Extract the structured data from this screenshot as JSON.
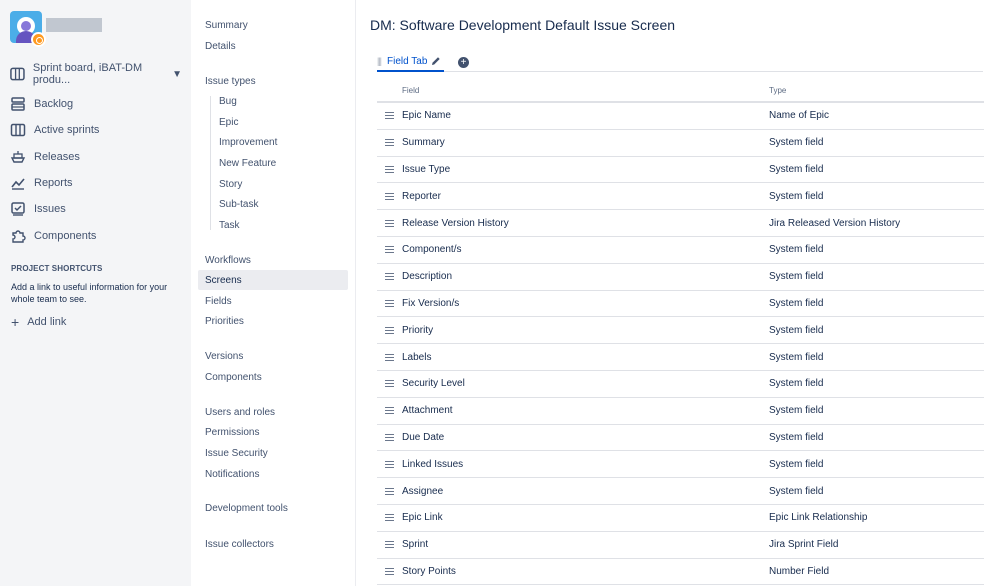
{
  "sidebar": {
    "board_label": "Sprint board, iBAT-DM produ...",
    "items": [
      {
        "label": "Backlog",
        "icon": "backlog-icon"
      },
      {
        "label": "Active sprints",
        "icon": "board-columns-icon"
      },
      {
        "label": "Releases",
        "icon": "ship-icon"
      },
      {
        "label": "Reports",
        "icon": "chart-icon"
      },
      {
        "label": "Issues",
        "icon": "issues-icon"
      },
      {
        "label": "Components",
        "icon": "puzzle-icon"
      }
    ],
    "shortcuts_title": "PROJECT SHORTCUTS",
    "shortcuts_desc": "Add a link to useful information for your whole team to see.",
    "add_link": "Add link"
  },
  "settings_nav": {
    "summary": "Summary",
    "details": "Details",
    "issue_types": "Issue types",
    "issue_type_items": [
      "Bug",
      "Epic",
      "Improvement",
      "New Feature",
      "Story",
      "Sub-task",
      "Task"
    ],
    "workflows": "Workflows",
    "screens": "Screens",
    "fields": "Fields",
    "priorities": "Priorities",
    "versions": "Versions",
    "components": "Components",
    "users_roles": "Users and roles",
    "permissions": "Permissions",
    "issue_security": "Issue Security",
    "notifications": "Notifications",
    "dev_tools": "Development tools",
    "issue_collectors": "Issue collectors"
  },
  "main": {
    "title": "DM: Software Development Default Issue Screen",
    "tab_label": "Field Tab",
    "columns": {
      "field": "Field",
      "type": "Type"
    },
    "rows": [
      {
        "field": "Epic Name",
        "type": "Name of Epic"
      },
      {
        "field": "Summary",
        "type": "System field"
      },
      {
        "field": "Issue Type",
        "type": "System field"
      },
      {
        "field": "Reporter",
        "type": "System field"
      },
      {
        "field": "Release Version History",
        "type": "Jira Released Version History"
      },
      {
        "field": "Component/s",
        "type": "System field"
      },
      {
        "field": "Description",
        "type": "System field"
      },
      {
        "field": "Fix Version/s",
        "type": "System field"
      },
      {
        "field": "Priority",
        "type": "System field"
      },
      {
        "field": "Labels",
        "type": "System field"
      },
      {
        "field": "Security Level",
        "type": "System field"
      },
      {
        "field": "Attachment",
        "type": "System field"
      },
      {
        "field": "Due Date",
        "type": "System field"
      },
      {
        "field": "Linked Issues",
        "type": "System field"
      },
      {
        "field": "Assignee",
        "type": "System field"
      },
      {
        "field": "Epic Link",
        "type": "Epic Link Relationship"
      },
      {
        "field": "Sprint",
        "type": "Jira Sprint Field"
      },
      {
        "field": "Story Points",
        "type": "Number Field"
      }
    ]
  }
}
